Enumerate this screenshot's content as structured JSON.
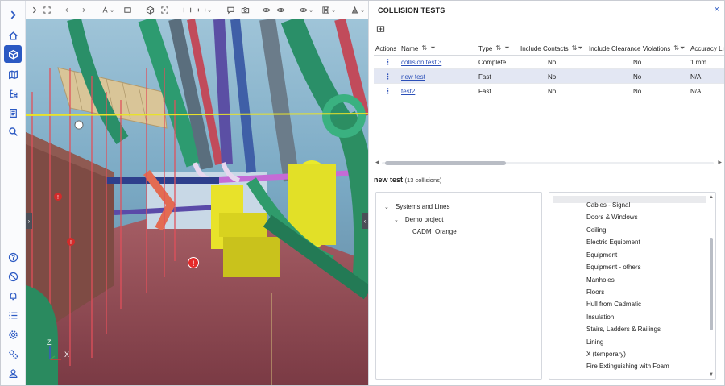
{
  "panel": {
    "title": "COLLISION TESTS",
    "close": "×"
  },
  "table": {
    "columns": [
      {
        "label": "Actions",
        "sortable": false
      },
      {
        "label": "Name",
        "sortable": true
      },
      {
        "label": "Type",
        "sortable": true
      },
      {
        "label": "Include Contacts",
        "sortable": true
      },
      {
        "label": "Include Clearance Violations",
        "sortable": true
      },
      {
        "label": "Accuracy Lim",
        "sortable": false
      }
    ],
    "rows": [
      {
        "name": "collision test 3",
        "type": "Complete",
        "contacts": "No",
        "clearance": "No",
        "accuracy": "1 mm",
        "selected": false
      },
      {
        "name": "new test",
        "type": "Fast",
        "contacts": "No",
        "clearance": "No",
        "accuracy": "N/A",
        "selected": true
      },
      {
        "name": "test2",
        "type": "Fast",
        "contacts": "No",
        "clearance": "No",
        "accuracy": "N/A",
        "selected": false
      }
    ]
  },
  "collisions": {
    "name": "new test",
    "count": "(13 collisions)"
  },
  "tree": {
    "items": [
      {
        "label": "Systems and Lines",
        "level": 0,
        "chevron": "⌄"
      },
      {
        "label": "Demo project",
        "level": 1,
        "chevron": "⌄"
      },
      {
        "label": "CADM_Orange",
        "level": 2,
        "chevron": ""
      }
    ]
  },
  "categories": [
    "Cables - Signal",
    "Doors & Windows",
    "Ceiling",
    "Electric Equipment",
    "Equipment",
    "Equipment - others",
    "Manholes",
    "Floors",
    "Hull from Cadmatic",
    "Insulation",
    "Stairs, Ladders & Railings",
    "Lining",
    "X (temporary)",
    "Fire Extinguishing with Foam"
  ],
  "viewport": {
    "axis_z": "Z",
    "axis_x": "X",
    "marker": "!"
  },
  "colors": {
    "accent": "#2b59c3",
    "link": "#2b4fb8",
    "selected_row": "#e3e7f3"
  }
}
